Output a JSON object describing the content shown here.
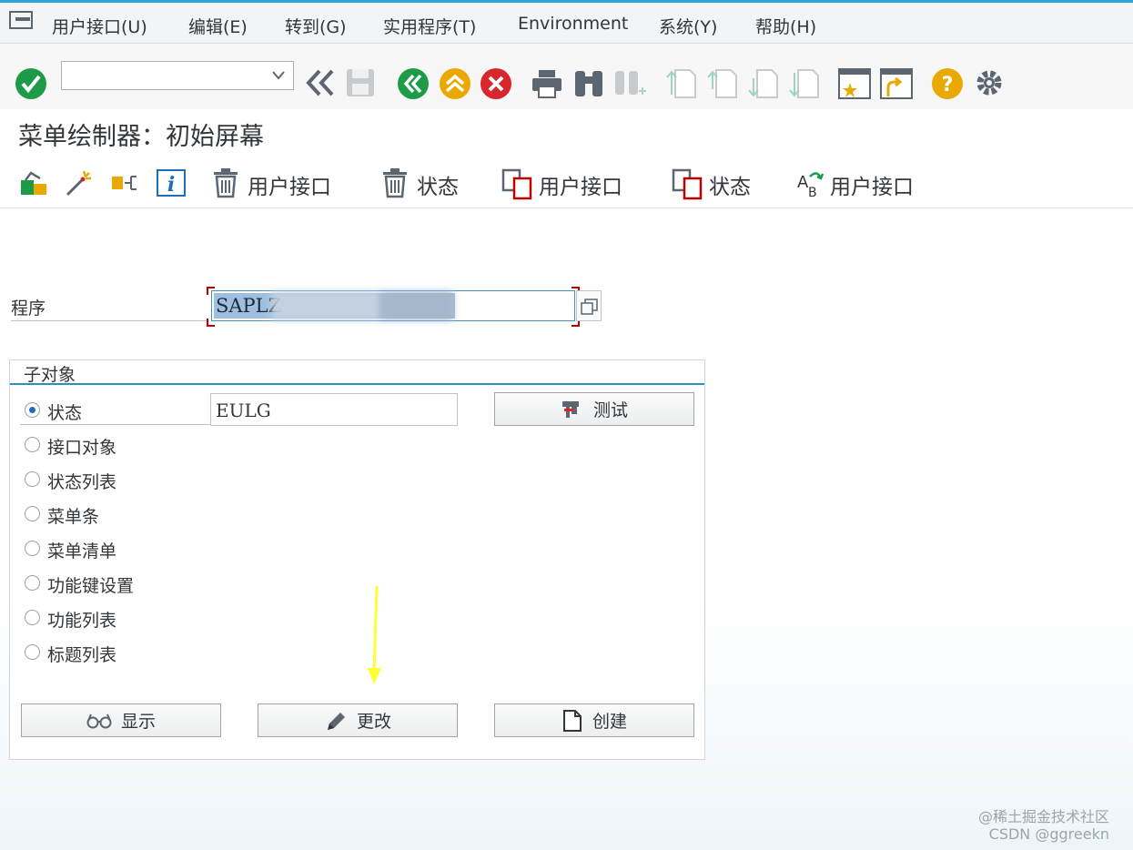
{
  "menubar": {
    "items": [
      "用户接口(U)",
      "编辑(E)",
      "转到(G)",
      "实用程序(T)",
      "Environment",
      "系统(Y)",
      "帮助(H)"
    ]
  },
  "toolbar": {
    "okcode_value": "",
    "icons": [
      "enter-icon",
      "back-double-icon",
      "save-icon",
      "back-icon",
      "exit-icon",
      "cancel-icon",
      "print-icon",
      "find-icon",
      "find-next-icon",
      "first-page-icon",
      "previous-page-icon",
      "next-page-icon",
      "last-page-icon",
      "create-session-icon",
      "shortcut-icon",
      "help-icon",
      "settings-icon"
    ]
  },
  "title": "菜单绘制器：初始屏幕",
  "app_toolbar": {
    "delete_gui": "用户接口",
    "delete_status": "状态",
    "copy_gui": "用户接口",
    "copy_status": "状态",
    "rename_gui": "用户接口"
  },
  "program": {
    "label": "程序",
    "value": "SAPLZ"
  },
  "subobjects": {
    "title": "子对象",
    "status_value": "EULG",
    "test_button": "测试",
    "options": [
      "状态",
      "接口对象",
      "状态列表",
      "菜单条",
      "菜单清单",
      "功能键设置",
      "功能列表",
      "标题列表"
    ],
    "selected": 0
  },
  "buttons": {
    "display": "显示",
    "change": "更改",
    "create": "创建"
  },
  "watermark": {
    "line1": "@稀土掘金技术社区",
    "line2": "CSDN @ggreekn"
  },
  "colors": {
    "accent": "#2aa7d8",
    "annotation_arrow": "#ffff33"
  }
}
